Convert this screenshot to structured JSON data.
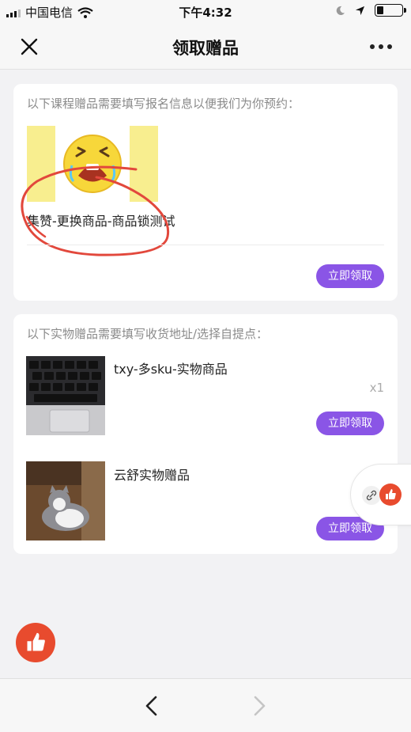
{
  "status_bar": {
    "carrier": "中国电信",
    "time": "下午4:32"
  },
  "nav": {
    "title": "领取赠品",
    "close_icon": "close-icon",
    "more_icon": "more-icon"
  },
  "course_section": {
    "hint": "以下课程赠品需要填写报名信息以便我们为你预约：",
    "items": [
      {
        "title": "集赞-更换商品-商品锁测试",
        "button": "立即领取"
      }
    ]
  },
  "physical_section": {
    "hint": "以下实物赠品需要填写收货地址/选择自提点：",
    "items": [
      {
        "title": "txy-多sku-实物商品",
        "qty": "x1",
        "button": "立即领取"
      },
      {
        "title": "云舒实物赠品",
        "button": "立即领取"
      }
    ]
  },
  "colors": {
    "accent": "#8a55e6",
    "like": "#e84b2e",
    "annotation": "#e2483c"
  }
}
